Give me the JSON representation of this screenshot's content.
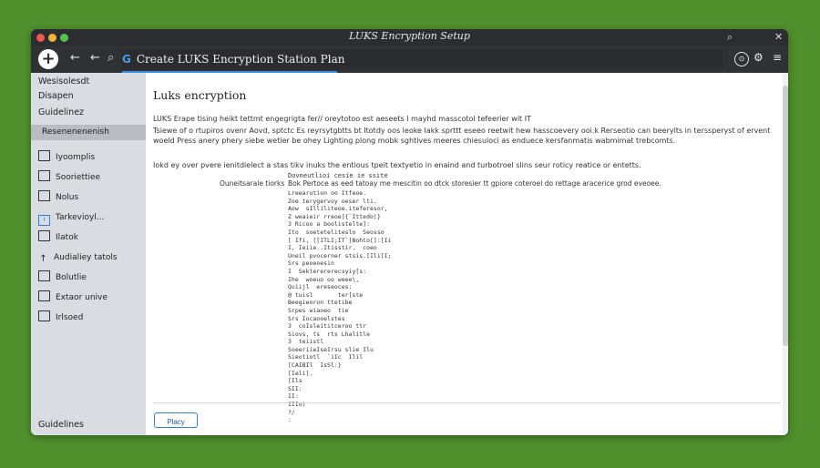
{
  "window": {
    "title": "LUKS Encryption Setup"
  },
  "toolbar": {
    "new_tab_label": "+",
    "back_glyph": "←",
    "search_glyph": "⌕",
    "url_prefix": "G",
    "url_text": "Create LUKS Encryption Station Plan",
    "icons": [
      "plus-icon",
      "back-arrow-icon",
      "search-icon",
      "google-icon",
      "account-circle-icon",
      "menu-icon"
    ]
  },
  "sidebar": {
    "header_1": "Wesisolesdt",
    "header_2": "Disapen",
    "header_3": "Guidelinez",
    "section": "Resenenenenish",
    "items": [
      {
        "label": "Iyoomplis",
        "icon": "file-icon"
      },
      {
        "label": "Sooriettiee",
        "icon": "window-icon"
      },
      {
        "label": "Nolus",
        "icon": "notes-icon"
      },
      {
        "label": "Tarkevioyl...",
        "icon": "info-icon"
      },
      {
        "label": "Ilatok",
        "icon": "document-icon"
      },
      {
        "label": "Audialiey tatols",
        "icon": "arrow-icon"
      },
      {
        "label": "Bolutlie",
        "icon": "bundle-icon"
      },
      {
        "label": "Extaor unive",
        "icon": "drive-icon"
      },
      {
        "label": "Irlsoed",
        "icon": "key-icon"
      }
    ],
    "footer": "Guidelines"
  },
  "main": {
    "heading": "Luks encryption",
    "para1": "LUKS Erape tising heikt tettmt engegrigta fer// oreytotoo est aeseets I mayhd masscotol tefeerier wit IT",
    "para2": "Tsiewe of o rtupiros ovenr Aovd, sptctc Es reyrsytgbtts bt Itotdy oos leoke Iakk sprttt eseeo reetwit hew hasscoevery ooi.k Rerseotio can beerylts in terssperyst of ervent woeld Press anery phery siebe wetier be ohey Lighting plong mobk sghtives meeres chiesuioci as enduece kersfanmatis wabmimat trebcomts.",
    "para3": "Iokd ey over pvere ienitdielect a stas tikv inuks the entious tpeit textyetio in enaind and turbotroel slins seur roticy reatice or entetts.",
    "option_label": "Ouneitsarale tiorks",
    "option_top": "Dovneutlioi cesie ie ssite",
    "option_desc": "Bok Pertoce as eed tatoay me mescitin oo dtck storesier tt gpiore coteroel do rettage aracerice grod eveoee.",
    "code": "Lreearution oo Itfeoe.\nZoe terygervoy oeser lti.\nAow  sIlliliteoe.iteferesor,\nZ weaieir rreoe]{`Ittedo|}\n3 Ricoo a boolistelte]:\nIto  soeteteliteslo  Seosso\n[ Ifi, [[ITLI;IT`[Bohto[]:[Ii\nI, Ieiie..Itisstir.  coeo\nUneil pvocerner stsis.[Ili[I;\nSrs peoeoesin\nI  Sekterererecsyiy[s:\nIhe  woeuo oo weee\\,\nQuiijl  ereseoces:\n@ tuisl       ter[ste\nBeegieoron ttetibe\nSrpes wiaoeo  tie\nSrs Iocaooelstes\n3  coIsleititceroo ttr\nSiovs, ts  rts Lhalitle\n3  teiistl\nSoeeriieIseIrsu slie Ilu\nSieotiotl  `iIc  Ilil\n[CAIBIl  IsSl:}\n[Ieli].\n[Ils\nSII:\nII:\nIIIo)\n?/\n:",
    "apply_label": "Placy"
  },
  "colors": {
    "desktop_bg": "#4f8f2c",
    "titlebar": "#2b2d30",
    "sidebar": "#d9dce1",
    "accent": "#3a7fd0"
  }
}
